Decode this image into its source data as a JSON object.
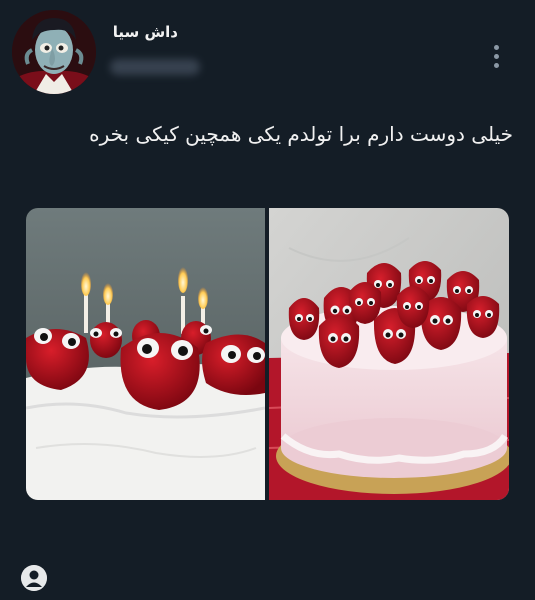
{
  "author": {
    "display_name": "داش سیا",
    "avatar_icon": "cartoon-avatar"
  },
  "post": {
    "text": "خیلی دوست دارم برا تولدم یکی همچین کیکی بخره",
    "more_icon": "more-vertical-icon",
    "images": [
      {
        "subject": "cake-with-googly-eye-strawberries-and-candles"
      },
      {
        "subject": "pink-cake-with-googly-eye-strawberries"
      }
    ]
  },
  "footer": {
    "account_icon": "account-icon"
  },
  "colors": {
    "background": "#141d26",
    "text": "#f1f1f1",
    "muted": "#8b98a5"
  }
}
